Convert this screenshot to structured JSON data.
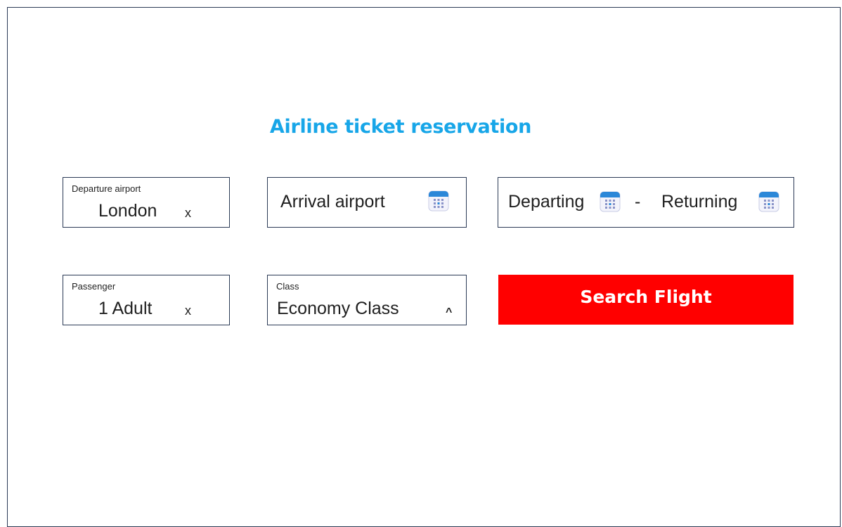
{
  "title": "Airline ticket reservation",
  "departure": {
    "label": "Departure airport",
    "value": "London",
    "clear_icon": "x"
  },
  "arrival": {
    "placeholder": "Arrival airport",
    "icon": "calendar-icon"
  },
  "dates": {
    "departing": "Departing",
    "separator": "-",
    "returning": "Returning",
    "icon": "calendar-icon"
  },
  "passenger": {
    "label": "Passenger",
    "value": "1 Adult",
    "clear_icon": "x"
  },
  "class": {
    "label": "Class",
    "value": "Economy Class",
    "caret": "^"
  },
  "search_button": {
    "label": "Search Flight"
  },
  "colors": {
    "title": "#17a6e8",
    "button": "#ff0000",
    "border": "#2b3a55",
    "calendar_top": "#2b87d8"
  }
}
